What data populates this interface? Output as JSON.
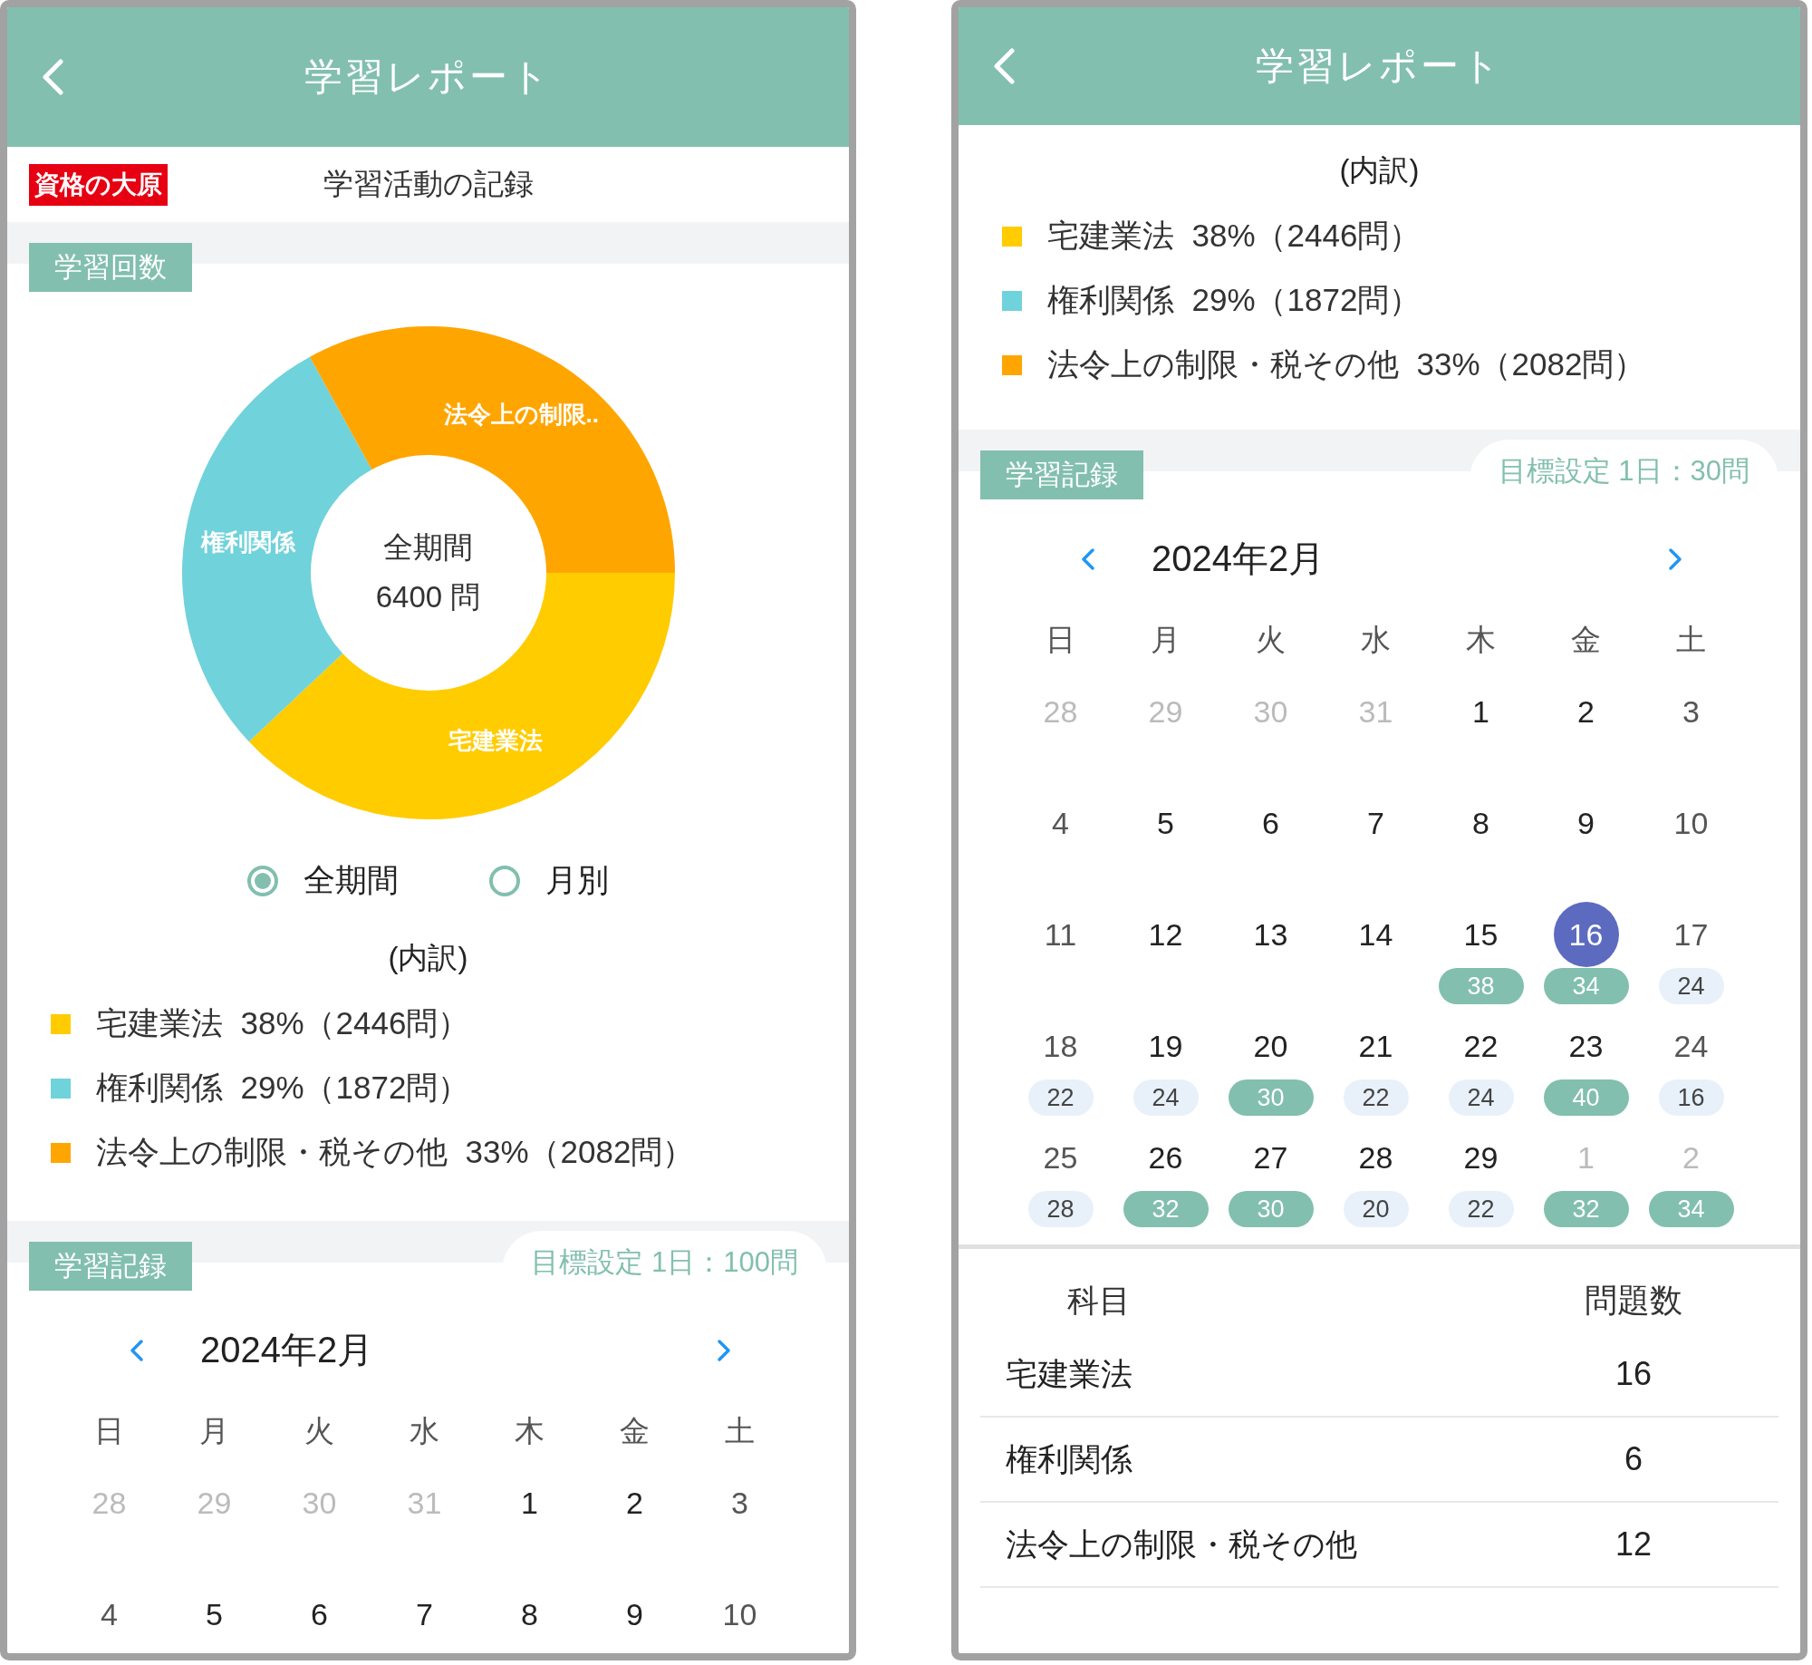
{
  "screens": [
    {
      "header": {
        "title": "学習レポート"
      },
      "sections": [
        {
          "kind": "brand_title",
          "logo": "資格の大原",
          "title": "学習活動の記録"
        },
        {
          "kind": "tag_band",
          "tag": "学習回数"
        },
        {
          "kind": "donut",
          "center_label": "全期間",
          "center_value": "6400 問",
          "chart_data": {
            "type": "donut",
            "categories": [
              "宅建業法",
              "権利関係",
              "法令上の制限.."
            ],
            "values": [
              38,
              29,
              33
            ]
          }
        },
        {
          "kind": "radios",
          "options": [
            {
              "label": "全期間",
              "selected": true
            },
            {
              "label": "月別",
              "selected": false
            }
          ]
        },
        {
          "kind": "breakdown",
          "heading": "(内訳)",
          "items": [
            {
              "color": "#ffcc00",
              "text": "宅建業法  38%（2446問）"
            },
            {
              "color": "#70d2db",
              "text": "権利関係  29%（1872問）"
            },
            {
              "color": "#ffa500",
              "text": "法令上の制限・税その他  33%（2082問）"
            }
          ]
        },
        {
          "kind": "record",
          "tag": "学習記録",
          "goal": "目標設定 1日：100問",
          "calendar": {
            "month": "2024年2月",
            "weekdays": [
              "日",
              "月",
              "火",
              "水",
              "木",
              "金",
              "土"
            ],
            "weeks": [
              [
                {
                  "day": "28",
                  "muted": true,
                  "selected": false
                },
                {
                  "day": "29",
                  "muted": true,
                  "selected": false
                },
                {
                  "day": "30",
                  "muted": true,
                  "selected": false
                },
                {
                  "day": "31",
                  "muted": true,
                  "selected": false
                },
                {
                  "day": "1",
                  "muted": false,
                  "selected": false
                },
                {
                  "day": "2",
                  "muted": false,
                  "selected": false
                },
                {
                  "day": "3",
                  "muted": false,
                  "selected": false
                }
              ],
              [
                {
                  "day": "4",
                  "muted": false,
                  "selected": false
                },
                {
                  "day": "5",
                  "muted": false,
                  "selected": false
                },
                {
                  "day": "6",
                  "muted": false,
                  "selected": false
                },
                {
                  "day": "7",
                  "muted": false,
                  "selected": false
                },
                {
                  "day": "8",
                  "muted": false,
                  "selected": false
                },
                {
                  "day": "9",
                  "muted": false,
                  "selected": false
                },
                {
                  "day": "10",
                  "muted": false,
                  "selected": false
                }
              ]
            ]
          }
        }
      ]
    },
    {
      "header": {
        "title": "学習レポート"
      },
      "sections": [
        {
          "kind": "breakdown",
          "heading": "(内訳)",
          "items": [
            {
              "color": "#ffcc00",
              "text": "宅建業法  38%（2446問）"
            },
            {
              "color": "#70d2db",
              "text": "権利関係  29%（1872問）"
            },
            {
              "color": "#ffa500",
              "text": "法令上の制限・税その他  33%（2082問）"
            }
          ]
        },
        {
          "kind": "record",
          "tag": "学習記録",
          "goal": "目標設定 1日：30問",
          "calendar": {
            "month": "2024年2月",
            "weekdays": [
              "日",
              "月",
              "火",
              "水",
              "木",
              "金",
              "土"
            ],
            "weeks": [
              [
                {
                  "day": "28",
                  "muted": true,
                  "selected": false
                },
                {
                  "day": "29",
                  "muted": true,
                  "selected": false
                },
                {
                  "day": "30",
                  "muted": true,
                  "selected": false
                },
                {
                  "day": "31",
                  "muted": true,
                  "selected": false
                },
                {
                  "day": "1",
                  "muted": false,
                  "selected": false
                },
                {
                  "day": "2",
                  "muted": false,
                  "selected": false
                },
                {
                  "day": "3",
                  "muted": false,
                  "selected": false
                }
              ],
              [
                {
                  "day": "4",
                  "muted": false,
                  "selected": false
                },
                {
                  "day": "5",
                  "muted": false,
                  "selected": false
                },
                {
                  "day": "6",
                  "muted": false,
                  "selected": false
                },
                {
                  "day": "7",
                  "muted": false,
                  "selected": false
                },
                {
                  "day": "8",
                  "muted": false,
                  "selected": false
                },
                {
                  "day": "9",
                  "muted": false,
                  "selected": false
                },
                {
                  "day": "10",
                  "muted": false,
                  "selected": false
                }
              ],
              [
                {
                  "day": "11",
                  "muted": false,
                  "selected": false
                },
                {
                  "day": "12",
                  "muted": false,
                  "selected": false
                },
                {
                  "day": "13",
                  "muted": false,
                  "selected": false
                },
                {
                  "day": "14",
                  "muted": false,
                  "selected": false
                },
                {
                  "day": "15",
                  "muted": false,
                  "selected": false,
                  "count": "38",
                  "met": true
                },
                {
                  "day": "16",
                  "muted": false,
                  "selected": true,
                  "count": "34",
                  "met": true
                },
                {
                  "day": "17",
                  "muted": false,
                  "selected": false,
                  "count": "24",
                  "met": false
                }
              ],
              [
                {
                  "day": "18",
                  "muted": false,
                  "selected": false,
                  "count": "22",
                  "met": false
                },
                {
                  "day": "19",
                  "muted": false,
                  "selected": false,
                  "count": "24",
                  "met": false
                },
                {
                  "day": "20",
                  "muted": false,
                  "selected": false,
                  "count": "30",
                  "met": true
                },
                {
                  "day": "21",
                  "muted": false,
                  "selected": false,
                  "count": "22",
                  "met": false
                },
                {
                  "day": "22",
                  "muted": false,
                  "selected": false,
                  "count": "24",
                  "met": false
                },
                {
                  "day": "23",
                  "muted": false,
                  "selected": false,
                  "count": "40",
                  "met": true
                },
                {
                  "day": "24",
                  "muted": false,
                  "selected": false,
                  "count": "16",
                  "met": false
                }
              ],
              [
                {
                  "day": "25",
                  "muted": false,
                  "selected": false,
                  "count": "28",
                  "met": false
                },
                {
                  "day": "26",
                  "muted": false,
                  "selected": false,
                  "count": "32",
                  "met": true
                },
                {
                  "day": "27",
                  "muted": false,
                  "selected": false,
                  "count": "30",
                  "met": true
                },
                {
                  "day": "28",
                  "muted": false,
                  "selected": false,
                  "count": "20",
                  "met": false
                },
                {
                  "day": "29",
                  "muted": false,
                  "selected": false,
                  "count": "22",
                  "met": false
                },
                {
                  "day": "1",
                  "muted": true,
                  "selected": false,
                  "count": "32",
                  "met": true
                },
                {
                  "day": "2",
                  "muted": true,
                  "selected": false,
                  "count": "34",
                  "met": true
                }
              ]
            ]
          }
        },
        {
          "kind": "table",
          "columns": [
            "科目",
            "問題数"
          ],
          "rows": [
            [
              "宅建業法",
              "16"
            ],
            [
              "権利関係",
              "6"
            ],
            [
              "法令上の制限・税その他",
              "12"
            ]
          ]
        }
      ]
    }
  ]
}
